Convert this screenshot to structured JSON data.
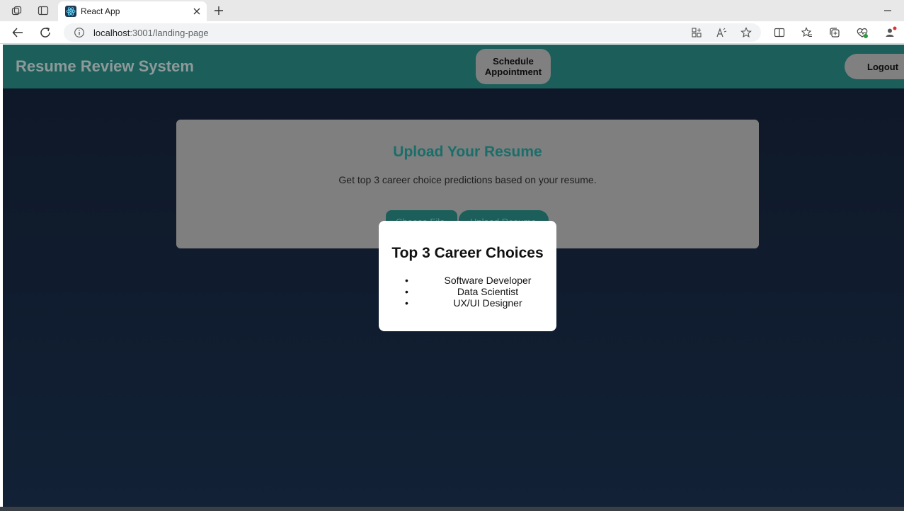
{
  "browser": {
    "tab_title": "React App",
    "url_host": "localhost",
    "url_path": ":3001/landing-page",
    "icons": [
      "workspaces-icon",
      "tab-actions-icon",
      "react-favicon",
      "close-icon",
      "new-tab-icon",
      "minimize-icon",
      "back-icon",
      "refresh-icon",
      "info-icon",
      "app-available-icon",
      "read-aloud-icon",
      "favorite-star-icon",
      "split-screen-icon",
      "favorites-icon",
      "collections-icon",
      "browser-essentials-icon",
      "profile-icon"
    ]
  },
  "app": {
    "title": "Resume Review System",
    "schedule_label": "Schedule Appointment",
    "logout_label": "Logout",
    "colors": {
      "header": "#1b5e5a",
      "accent": "#1a6e6a",
      "background": "#0e1726"
    }
  },
  "upload": {
    "title": "Upload Your Resume",
    "subtitle": "Get top 3 career choice predictions based on your resume.",
    "choose_label": "Choose File",
    "upload_label": "Upload Resume"
  },
  "modal": {
    "title": "Top 3 Career Choices",
    "items": [
      "Software Developer",
      "Data Scientist",
      "UX/UI Designer"
    ]
  }
}
